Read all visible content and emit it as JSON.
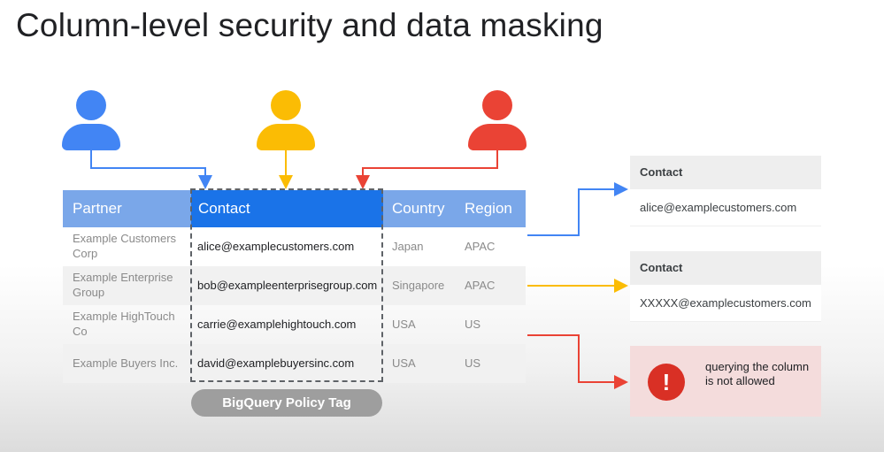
{
  "title": "Column-level security and data masking",
  "colors": {
    "user_blue": "#4285f4",
    "user_yellow": "#fbbc04",
    "user_red": "#ea4335",
    "header_light": "#7aa7e9",
    "header_contact": "#1a73e8",
    "denied_bg": "#f4dcdc",
    "alert": "#d93025"
  },
  "users": [
    {
      "name": "blue-user-icon",
      "color": "#4285f4"
    },
    {
      "name": "yellow-user-icon",
      "color": "#fbbc04"
    },
    {
      "name": "red-user-icon",
      "color": "#ea4335"
    }
  ],
  "table": {
    "headers": {
      "partner": "Partner",
      "contact": "Contact",
      "country": "Country",
      "region": "Region"
    },
    "rows": [
      {
        "partner": "Example Customers Corp",
        "contact": "alice@examplecustomers.com",
        "country": "Japan",
        "region": "APAC"
      },
      {
        "partner": "Example Enterprise Group",
        "contact": "bob@exampleenterprisegroup.com",
        "country": "Singapore",
        "region": "APAC"
      },
      {
        "partner": "Example HighTouch Co",
        "contact": "carrie@examplehightouch.com",
        "country": "USA",
        "region": "US"
      },
      {
        "partner": "Example Buyers Inc.",
        "contact": "david@examplebuyersinc.com",
        "country": "USA",
        "region": "US"
      }
    ]
  },
  "policy_tag": "BigQuery Policy Tag",
  "results": {
    "full": {
      "header": "Contact",
      "value": "alice@examplecustomers.com"
    },
    "masked": {
      "header": "Contact",
      "value": "XXXXX@examplecustomers.com"
    },
    "denied": {
      "icon": "!",
      "message": "querying the column is not allowed"
    }
  }
}
